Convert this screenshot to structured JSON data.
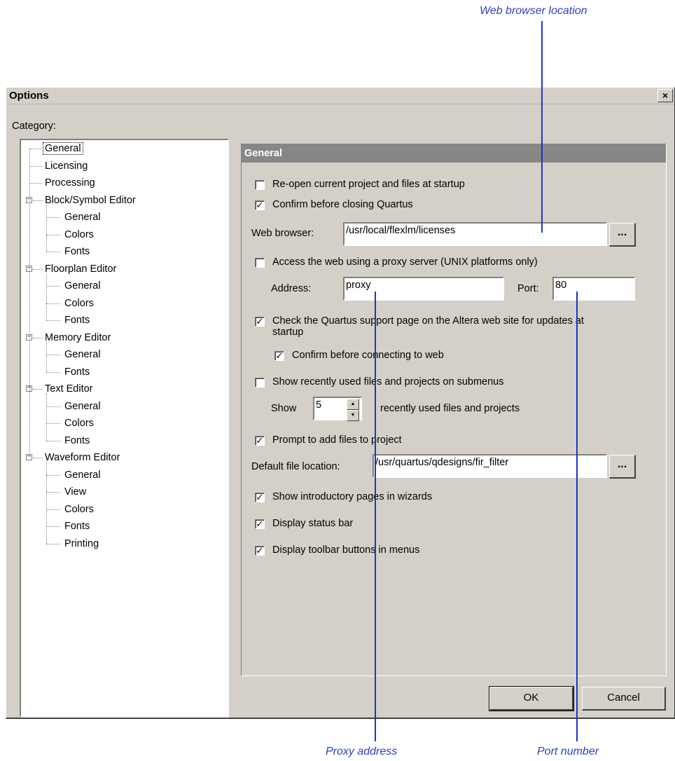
{
  "callouts": {
    "web_browser_location": "Web browser location",
    "proxy_address": "Proxy address",
    "port_number": "Port number"
  },
  "dialog": {
    "title": "Options",
    "close_label": "×"
  },
  "category": {
    "label": "Category:",
    "tree": [
      {
        "label": "General",
        "selected": true
      },
      {
        "label": "Licensing"
      },
      {
        "label": "Processing"
      },
      {
        "label": "Block/Symbol Editor",
        "children": [
          "General",
          "Colors",
          "Fonts"
        ]
      },
      {
        "label": "Floorplan Editor",
        "children": [
          "General",
          "Colors",
          "Fonts"
        ]
      },
      {
        "label": "Memory Editor",
        "children": [
          "General",
          "Fonts"
        ]
      },
      {
        "label": "Text Editor",
        "children": [
          "General",
          "Colors",
          "Fonts"
        ]
      },
      {
        "label": "Waveform Editor",
        "children": [
          "General",
          "View",
          "Colors",
          "Fonts",
          "Printing"
        ]
      }
    ],
    "expander_icon": "minus-box-icon"
  },
  "panel": {
    "header": "General",
    "reopen": {
      "label": "Re-open current project and files at startup",
      "checked": false
    },
    "confirm_close": {
      "label": "Confirm before closing Quartus",
      "checked": true
    },
    "web_browser": {
      "label": "Web browser:",
      "value": "/usr/local/flexlm/licenses",
      "browse": "..."
    },
    "proxy": {
      "label": "Access the web using a proxy server (UNIX platforms only)",
      "checked": false
    },
    "address": {
      "label": "Address:",
      "value": "proxy"
    },
    "port": {
      "label": "Port:",
      "value": "80"
    },
    "check_updates": {
      "label_line1": "Check the Quartus support page on the Altera web site for updates at",
      "label_line2": "startup",
      "checked": true
    },
    "confirm_connect": {
      "label": "Confirm before connecting to web",
      "checked": true
    },
    "show_recent": {
      "label": "Show recently used files and projects on submenus",
      "checked": false
    },
    "show_count": {
      "label": "Show",
      "value": "5",
      "suffix": "recently used files and projects"
    },
    "prompt_add": {
      "label": "Prompt to add files to project",
      "checked": true
    },
    "default_location": {
      "label": "Default file location:",
      "value": "/usr/quartus/qdesigns/fir_filter",
      "browse": "..."
    },
    "intro_pages": {
      "label": "Show introductory pages in wizards",
      "checked": true
    },
    "status_bar": {
      "label": "Display status bar",
      "checked": true
    },
    "toolbar_buttons": {
      "label": "Display toolbar buttons in menus",
      "checked": true
    }
  },
  "buttons": {
    "ok": "OK",
    "cancel": "Cancel"
  },
  "colors": {
    "dialog_bg": "#d4d0c8",
    "panel_header_bg": "#878787",
    "callout_text": "#2b3fbf",
    "callout_line": "#1a35c8"
  }
}
